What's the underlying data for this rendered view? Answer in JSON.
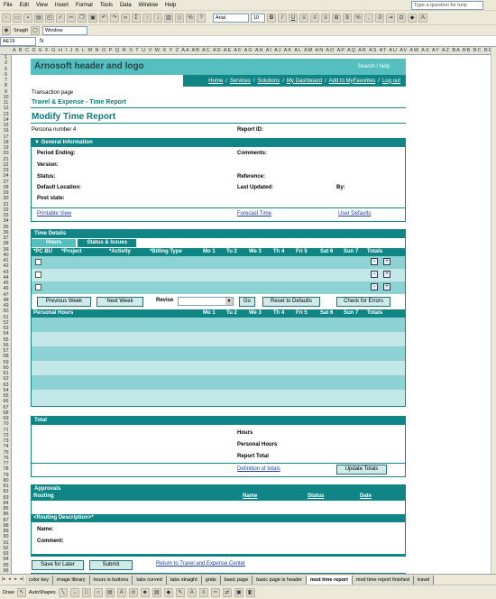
{
  "excel": {
    "menu": [
      "File",
      "Edit",
      "View",
      "Insert",
      "Format",
      "Tools",
      "Data",
      "Window",
      "Help"
    ],
    "help_placeholder": "Type a question for help",
    "font_name": "Arial",
    "font_size": "10",
    "snagit_label": "SnagIt",
    "window_label": "Window",
    "name_box": "AE19",
    "column_letters": "A B C D E F G H I J K L M N O P Q R S T U V W X Y Z AA AB AC AD AE AF AG AH AI AJ AK AL AM AN AO AP AQ AR AS AT AU AV AW AX AY AZ BA BB BC BD",
    "row_numbers": [
      "1",
      "2",
      "5",
      "6",
      "7",
      "8",
      "9",
      "10",
      "11",
      "12",
      "13",
      "14",
      "15",
      "16",
      "17",
      "18",
      "19",
      "20",
      "21",
      "22",
      "23",
      "24",
      "27",
      "28",
      "29",
      "30",
      "31",
      "32",
      "33",
      "34",
      "35",
      "36",
      "37",
      "38",
      "39",
      "40",
      "41",
      "42",
      "43",
      "44",
      "45",
      "46",
      "47",
      "48",
      "49",
      "50",
      "51",
      "52",
      "53",
      "54",
      "55",
      "56",
      "57",
      "58",
      "59",
      "60",
      "61",
      "62",
      "63",
      "64",
      "65",
      "66",
      "67",
      "68",
      "69",
      "70",
      "71",
      "72",
      "73",
      "74",
      "75",
      "76",
      "77",
      "78",
      "79",
      "80",
      "81",
      "82",
      "83",
      "84",
      "85",
      "86",
      "87",
      "88",
      "89",
      "90",
      "91",
      "92",
      "93",
      "94",
      "95",
      "96"
    ],
    "sheet_tabs": [
      "color key",
      "image library",
      "hours is buttons",
      "tabs curved",
      "tabs straight",
      "grids",
      "basic page",
      "basic page is header",
      "mod time report",
      "mod time report finished",
      "travel"
    ],
    "active_tab": "mod time report",
    "draw_label": "Draw",
    "autoshapes_label": "AutoShapes"
  },
  "header": {
    "title": "Arnosoft header and logo",
    "search": "Search / help",
    "nav": [
      "Home",
      "Services",
      "Solutions",
      "My Dashboard",
      "Add to MyFavorites",
      "Log out"
    ]
  },
  "page": {
    "transaction": "Transaction page",
    "breadcrumb": "Travel & Expense - Time Report",
    "title": "Modify Time Report",
    "persona": "Persona number 4",
    "report_id_label": "Report ID:"
  },
  "general": {
    "heading": "General Information",
    "period_ending": "Period Ending:",
    "comments": "Comments:",
    "version": "Version:",
    "status": "Status:",
    "reference": "Reference:",
    "default_location": "Default Location:",
    "last_updated": "Last Updated:",
    "by": "By:",
    "post_state": "Post state:",
    "printable_view": "Printable View",
    "forecast_time": "Forecast Time",
    "user_defaults": "User Defaults"
  },
  "time_details": {
    "heading": "Time Details",
    "tabs": [
      "Hours",
      "Status & Issues"
    ],
    "active_tab": "Status & Issues",
    "columns": [
      "*PC BU",
      "*Project",
      "*Activity",
      "*Billing Type",
      "Mo 1",
      "Tu 2",
      "We 3",
      "Th 4",
      "Fri 5",
      "Sat 6",
      "Sun 7",
      "Totals"
    ],
    "buttons": {
      "previous_week": "Previous Week",
      "next_week": "Next Week",
      "revise": "Revise",
      "go": "Go",
      "reset": "Reset to Defaults",
      "check": "Check for Errors"
    },
    "personal_columns": [
      "Personal Hours",
      "Mo 1",
      "Tu 2",
      "We 3",
      "Th 4",
      "Fri 5",
      "Sat 6",
      "Sun 7",
      "Totals"
    ]
  },
  "total": {
    "heading": "Total",
    "hours": "Hours",
    "personal_hours": "Personal Hours",
    "report_total": "Report Total",
    "definition": "Definition of totals",
    "update_totals": "Update Totals"
  },
  "approvals": {
    "heading": "Approvals",
    "columns": [
      "Routing",
      "Name",
      "Status",
      "Date"
    ],
    "routing_desc": "<Routing Description>*",
    "name": "Name:",
    "comment": "Comment:"
  },
  "footer": {
    "save_later": "Save for Later",
    "submit": "Submit",
    "return": "Return to Travel and Expense Center",
    "note": "* or Approval Justification"
  }
}
